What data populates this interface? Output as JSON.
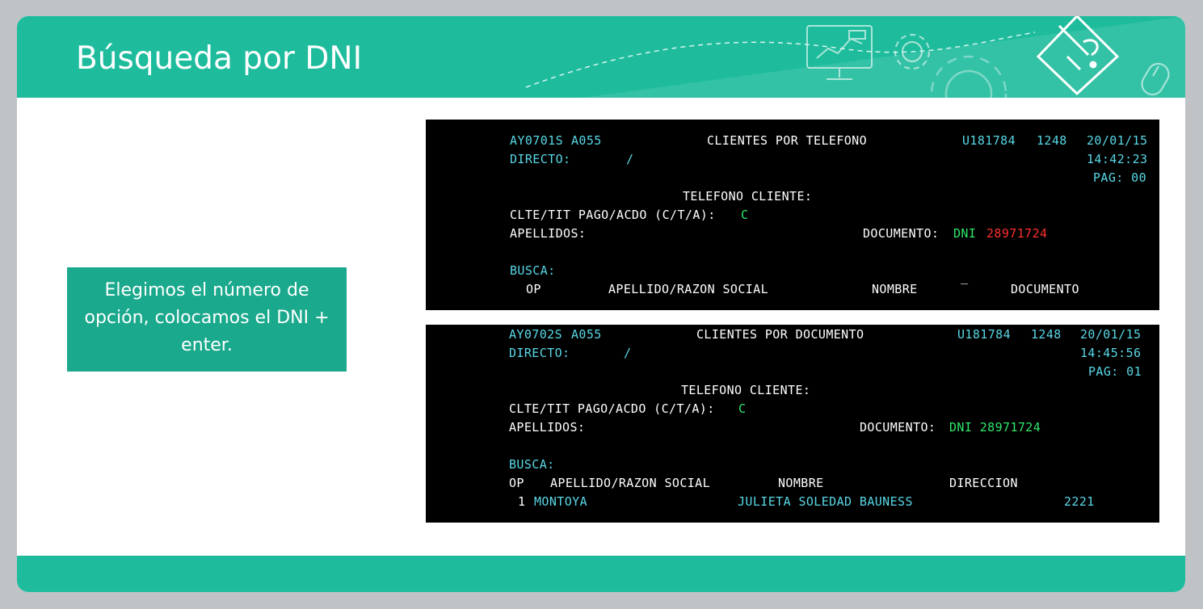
{
  "slide": {
    "title": "Búsqueda por DNI",
    "callout": "Elegimos el número de opción, colocamos el DNI + enter.",
    "colors": {
      "header": "#1ebc9d",
      "callout": "#1aa98c",
      "cyan": "#58d7e6",
      "green": "#2ee86b",
      "red": "#ff3030"
    }
  },
  "screen1": {
    "program": "AY0701S",
    "code": "A055",
    "title": "CLIENTES POR TELEFONO",
    "user": "U181784",
    "terminal": "1248",
    "date": "20/01/15",
    "time": "14:42:23",
    "page": "PAG: 00",
    "directo_label": "DIRECTO:",
    "directo_value": "/",
    "telefono_label": "TELEFONO CLIENTE:",
    "clte_label": "CLTE/TIT PAGO/ACDO (C/T/A):",
    "clte_value": "C",
    "apellidos_label": "APELLIDOS:",
    "documento_label": "DOCUMENTO:",
    "doc_type": "DNI",
    "doc_number": "28971724",
    "busca_label": "BUSCA:",
    "cursor": "_",
    "columns": [
      "OP",
      "APELLIDO/RAZON SOCIAL",
      "NOMBRE",
      "DOCUMENTO"
    ]
  },
  "screen2": {
    "program": "AY0702S",
    "code": "A055",
    "title": "CLIENTES POR DOCUMENTO",
    "user": "U181784",
    "terminal": "1248",
    "date": "20/01/15",
    "time": "14:45:56",
    "page": "PAG: 01",
    "directo_label": "DIRECTO:",
    "directo_value": "/",
    "telefono_label": "TELEFONO CLIENTE:",
    "clte_label": "CLTE/TIT PAGO/ACDO (C/T/A):",
    "clte_value": "C",
    "apellidos_label": "APELLIDOS:",
    "documento_label": "DOCUMENTO:",
    "doc_value": "DNI 28971724",
    "busca_label": "BUSCA:",
    "columns": [
      "OP",
      "APELLIDO/RAZON SOCIAL",
      "NOMBRE",
      "DIRECCION"
    ],
    "rows": [
      {
        "op": "1",
        "apellido": "MONTOYA",
        "nombre": "JULIETA SOLEDAD BAUNESS",
        "direccion": "2221"
      }
    ]
  }
}
